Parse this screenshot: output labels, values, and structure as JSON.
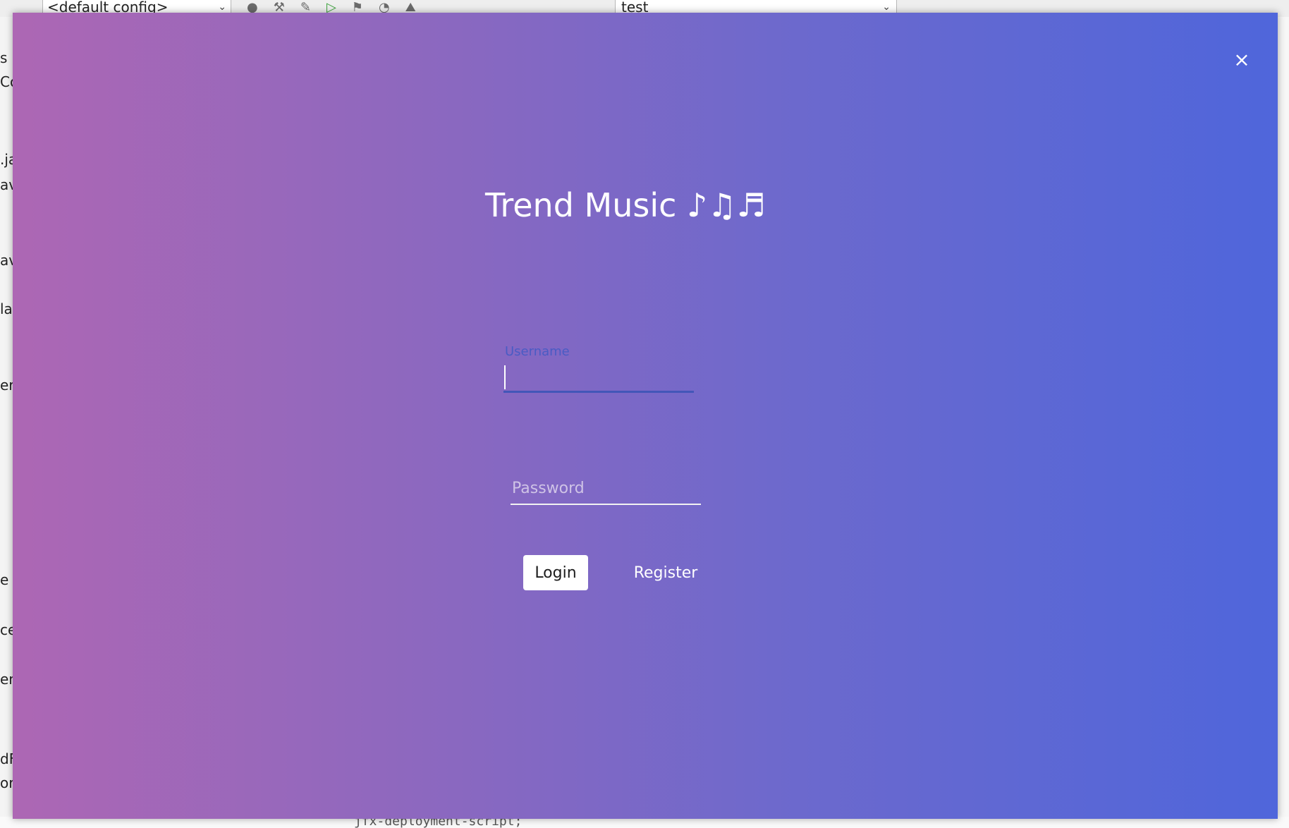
{
  "ide": {
    "config_select": "<default config>",
    "run_target": "test",
    "left_fragments": [
      "s",
      "Co",
      ".ja",
      "av",
      "av",
      "lar",
      "er",
      "e",
      "ce",
      "en",
      "dF",
      "or"
    ],
    "bottom_code": "jfx-deployment-script;"
  },
  "login": {
    "title": "Trend Music ♪♫♬",
    "close_icon": "×",
    "username": {
      "label": "Username",
      "value": ""
    },
    "password": {
      "placeholder": "Password",
      "value": ""
    },
    "login_label": "Login",
    "register_label": "Register",
    "colors": {
      "gradient_start": "#ad67b4",
      "gradient_end": "#4f66db",
      "focus_underline": "#4356b8"
    }
  }
}
